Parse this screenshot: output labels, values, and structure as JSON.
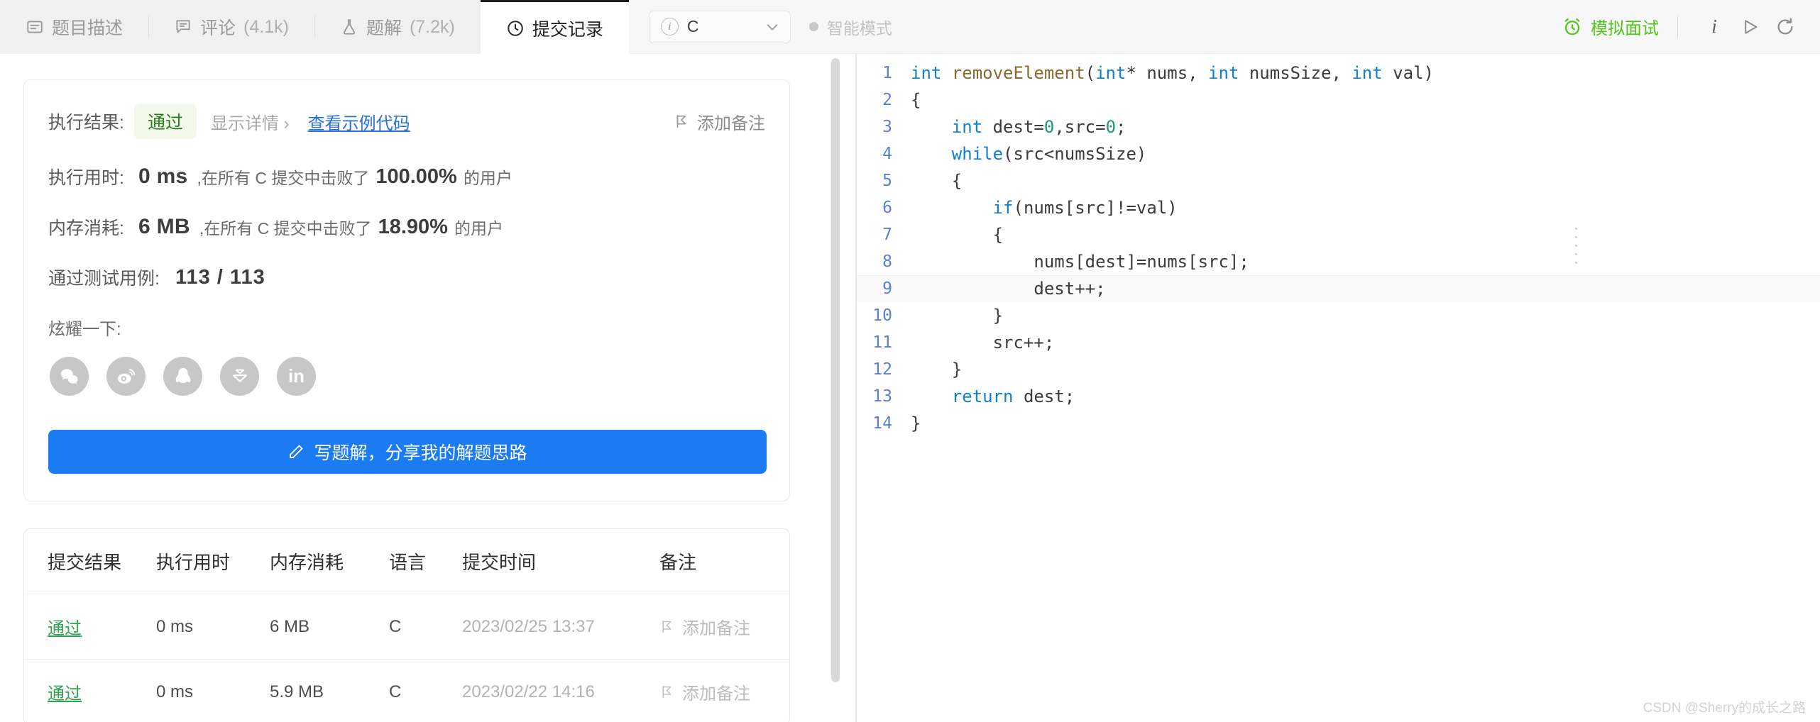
{
  "tabs": [
    {
      "label": "题目描述",
      "icon": "description-icon",
      "count": "",
      "active": false
    },
    {
      "label": "评论",
      "icon": "comment-icon",
      "count": "(4.1k)",
      "active": false
    },
    {
      "label": "题解",
      "icon": "flask-icon",
      "count": "(7.2k)",
      "active": false
    },
    {
      "label": "提交记录",
      "icon": "clock-icon",
      "count": "",
      "active": true
    }
  ],
  "toolbar": {
    "language": "C",
    "language_info_icon": "info-circle-icon",
    "dropdown_icon": "chevron-down-icon",
    "smart_mode_label": "智能模式",
    "smart_mode_dot": "status-dot",
    "mock_interview_label": "模拟面试",
    "mock_interview_icon": "alarm-clock-icon",
    "info_icon": "info-italic-icon",
    "run_icon": "play-icon",
    "reset_icon": "reset-icon",
    "accent_green": "#52c41a"
  },
  "result": {
    "result_label": "执行结果:",
    "status": "通过",
    "status_color": "#2c7a1f",
    "status_bg": "#f2f8ea",
    "show_detail": "显示详情 ›",
    "view_sample_code": "查看示例代码",
    "add_note": "添加备注",
    "add_note_icon": "flag-icon",
    "runtime_label": "执行用时:",
    "runtime_value": "0 ms",
    "runtime_text_before": ",在所有 C 提交中击败了",
    "runtime_percent": "100.00%",
    "runtime_text_after": "的用户",
    "memory_label": "内存消耗:",
    "memory_value": "6 MB",
    "memory_text_before": ",在所有 C 提交中击败了",
    "memory_percent": "18.90%",
    "memory_text_after": "的用户",
    "cases_label": "通过测试用例:",
    "cases_value": "113 / 113",
    "share_label": "炫耀一下:",
    "share_icons": [
      {
        "name": "wechat-icon",
        "glyph": "wechat"
      },
      {
        "name": "weibo-icon",
        "glyph": "weibo"
      },
      {
        "name": "qq-icon",
        "glyph": "qq"
      },
      {
        "name": "juejin-icon",
        "glyph": "juejin"
      },
      {
        "name": "linkedin-icon",
        "glyph": "in"
      }
    ],
    "cta_label": "写题解，分享我的解题思路",
    "cta_icon": "pencil-icon",
    "cta_color": "#1a7bf2"
  },
  "submissions": {
    "headers": [
      "提交结果",
      "执行用时",
      "内存消耗",
      "语言",
      "提交时间",
      "备注"
    ],
    "rows": [
      {
        "result": "通过",
        "runtime": "0 ms",
        "memory": "6 MB",
        "language": "C",
        "time": "2023/02/25 13:37",
        "note": "添加备注",
        "note_icon": "flag-icon"
      },
      {
        "result": "通过",
        "runtime": "0 ms",
        "memory": "5.9 MB",
        "language": "C",
        "time": "2023/02/22 14:16",
        "note": "添加备注",
        "note_icon": "flag-icon"
      }
    ]
  },
  "code": {
    "lines": [
      {
        "n": "1",
        "segments": [
          {
            "t": "int ",
            "c": "kw"
          },
          {
            "t": "removeElement",
            "c": "fn"
          },
          {
            "t": "(",
            "c": "pn"
          },
          {
            "t": "int",
            "c": "kw"
          },
          {
            "t": "* nums, ",
            "c": "pn"
          },
          {
            "t": "int",
            "c": "kw"
          },
          {
            "t": " numsSize, ",
            "c": "pn"
          },
          {
            "t": "int",
            "c": "kw"
          },
          {
            "t": " val)",
            "c": "pn"
          }
        ]
      },
      {
        "n": "2",
        "segments": [
          {
            "t": "{",
            "c": "pn"
          }
        ]
      },
      {
        "n": "3",
        "segments": [
          {
            "t": "    ",
            "c": "pn"
          },
          {
            "t": "int",
            "c": "kw"
          },
          {
            "t": " dest=",
            "c": "pn"
          },
          {
            "t": "0",
            "c": "num"
          },
          {
            "t": ",src=",
            "c": "pn"
          },
          {
            "t": "0",
            "c": "num"
          },
          {
            "t": ";",
            "c": "pn"
          }
        ]
      },
      {
        "n": "4",
        "segments": [
          {
            "t": "    ",
            "c": "pn"
          },
          {
            "t": "while",
            "c": "kw"
          },
          {
            "t": "(src<numsSize)",
            "c": "pn"
          }
        ]
      },
      {
        "n": "5",
        "segments": [
          {
            "t": "    {",
            "c": "pn"
          }
        ]
      },
      {
        "n": "6",
        "segments": [
          {
            "t": "        ",
            "c": "pn"
          },
          {
            "t": "if",
            "c": "kw"
          },
          {
            "t": "(nums[src]!=val)",
            "c": "pn"
          }
        ]
      },
      {
        "n": "7",
        "segments": [
          {
            "t": "        {",
            "c": "pn"
          }
        ]
      },
      {
        "n": "8",
        "segments": [
          {
            "t": "            nums[dest]=nums[src];",
            "c": "pn"
          }
        ]
      },
      {
        "n": "9",
        "segments": [
          {
            "t": "            dest++;",
            "c": "pn"
          }
        ]
      },
      {
        "n": "10",
        "segments": [
          {
            "t": "        }",
            "c": "pn"
          }
        ]
      },
      {
        "n": "11",
        "segments": [
          {
            "t": "        src++;",
            "c": "pn"
          }
        ]
      },
      {
        "n": "12",
        "segments": [
          {
            "t": "    }",
            "c": "pn"
          }
        ]
      },
      {
        "n": "13",
        "segments": [
          {
            "t": "    ",
            "c": "pn"
          },
          {
            "t": "return",
            "c": "kw"
          },
          {
            "t": " dest;",
            "c": "pn"
          }
        ]
      },
      {
        "n": "14",
        "segments": [
          {
            "t": "}",
            "c": "pn"
          }
        ]
      }
    ],
    "highlight_line": "9"
  },
  "watermark": "CSDN @Sherry的成长之路"
}
